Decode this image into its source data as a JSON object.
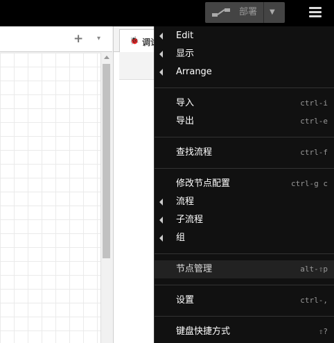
{
  "header": {
    "deploy_label": "部署",
    "deploy_icon": "deploy-flow-icon",
    "menu_icon": "hamburger-menu-icon"
  },
  "workspace": {
    "add_icon": "+",
    "caret": "▾"
  },
  "sidebar": {
    "tab_icon": "bug-icon",
    "tab_glyph": "🐞",
    "tab_label": "调试"
  },
  "menu": {
    "items": [
      {
        "label": "Edit",
        "submenu": true,
        "shortcut": ""
      },
      {
        "label": "显示",
        "submenu": true,
        "shortcut": ""
      },
      {
        "label": "Arrange",
        "submenu": true,
        "shortcut": ""
      },
      {
        "label": "导入",
        "submenu": false,
        "shortcut": "ctrl-i"
      },
      {
        "label": "导出",
        "submenu": false,
        "shortcut": "ctrl-e"
      },
      {
        "label": "查找流程",
        "submenu": false,
        "shortcut": "ctrl-f"
      },
      {
        "label": "修改节点配置",
        "submenu": false,
        "shortcut": "ctrl-g c"
      },
      {
        "label": "流程",
        "submenu": true,
        "shortcut": ""
      },
      {
        "label": "子流程",
        "submenu": true,
        "shortcut": ""
      },
      {
        "label": "组",
        "submenu": true,
        "shortcut": ""
      },
      {
        "label": "节点管理",
        "submenu": false,
        "shortcut": "alt-⇧p"
      },
      {
        "label": "设置",
        "submenu": false,
        "shortcut": "ctrl-,"
      },
      {
        "label": "键盘快捷方式",
        "submenu": false,
        "shortcut": "⇧?"
      }
    ]
  },
  "colors": {
    "header_bg": "#000000",
    "menu_bg": "#111111",
    "menu_highlight": "#222222",
    "deploy_bg": "#444444"
  }
}
